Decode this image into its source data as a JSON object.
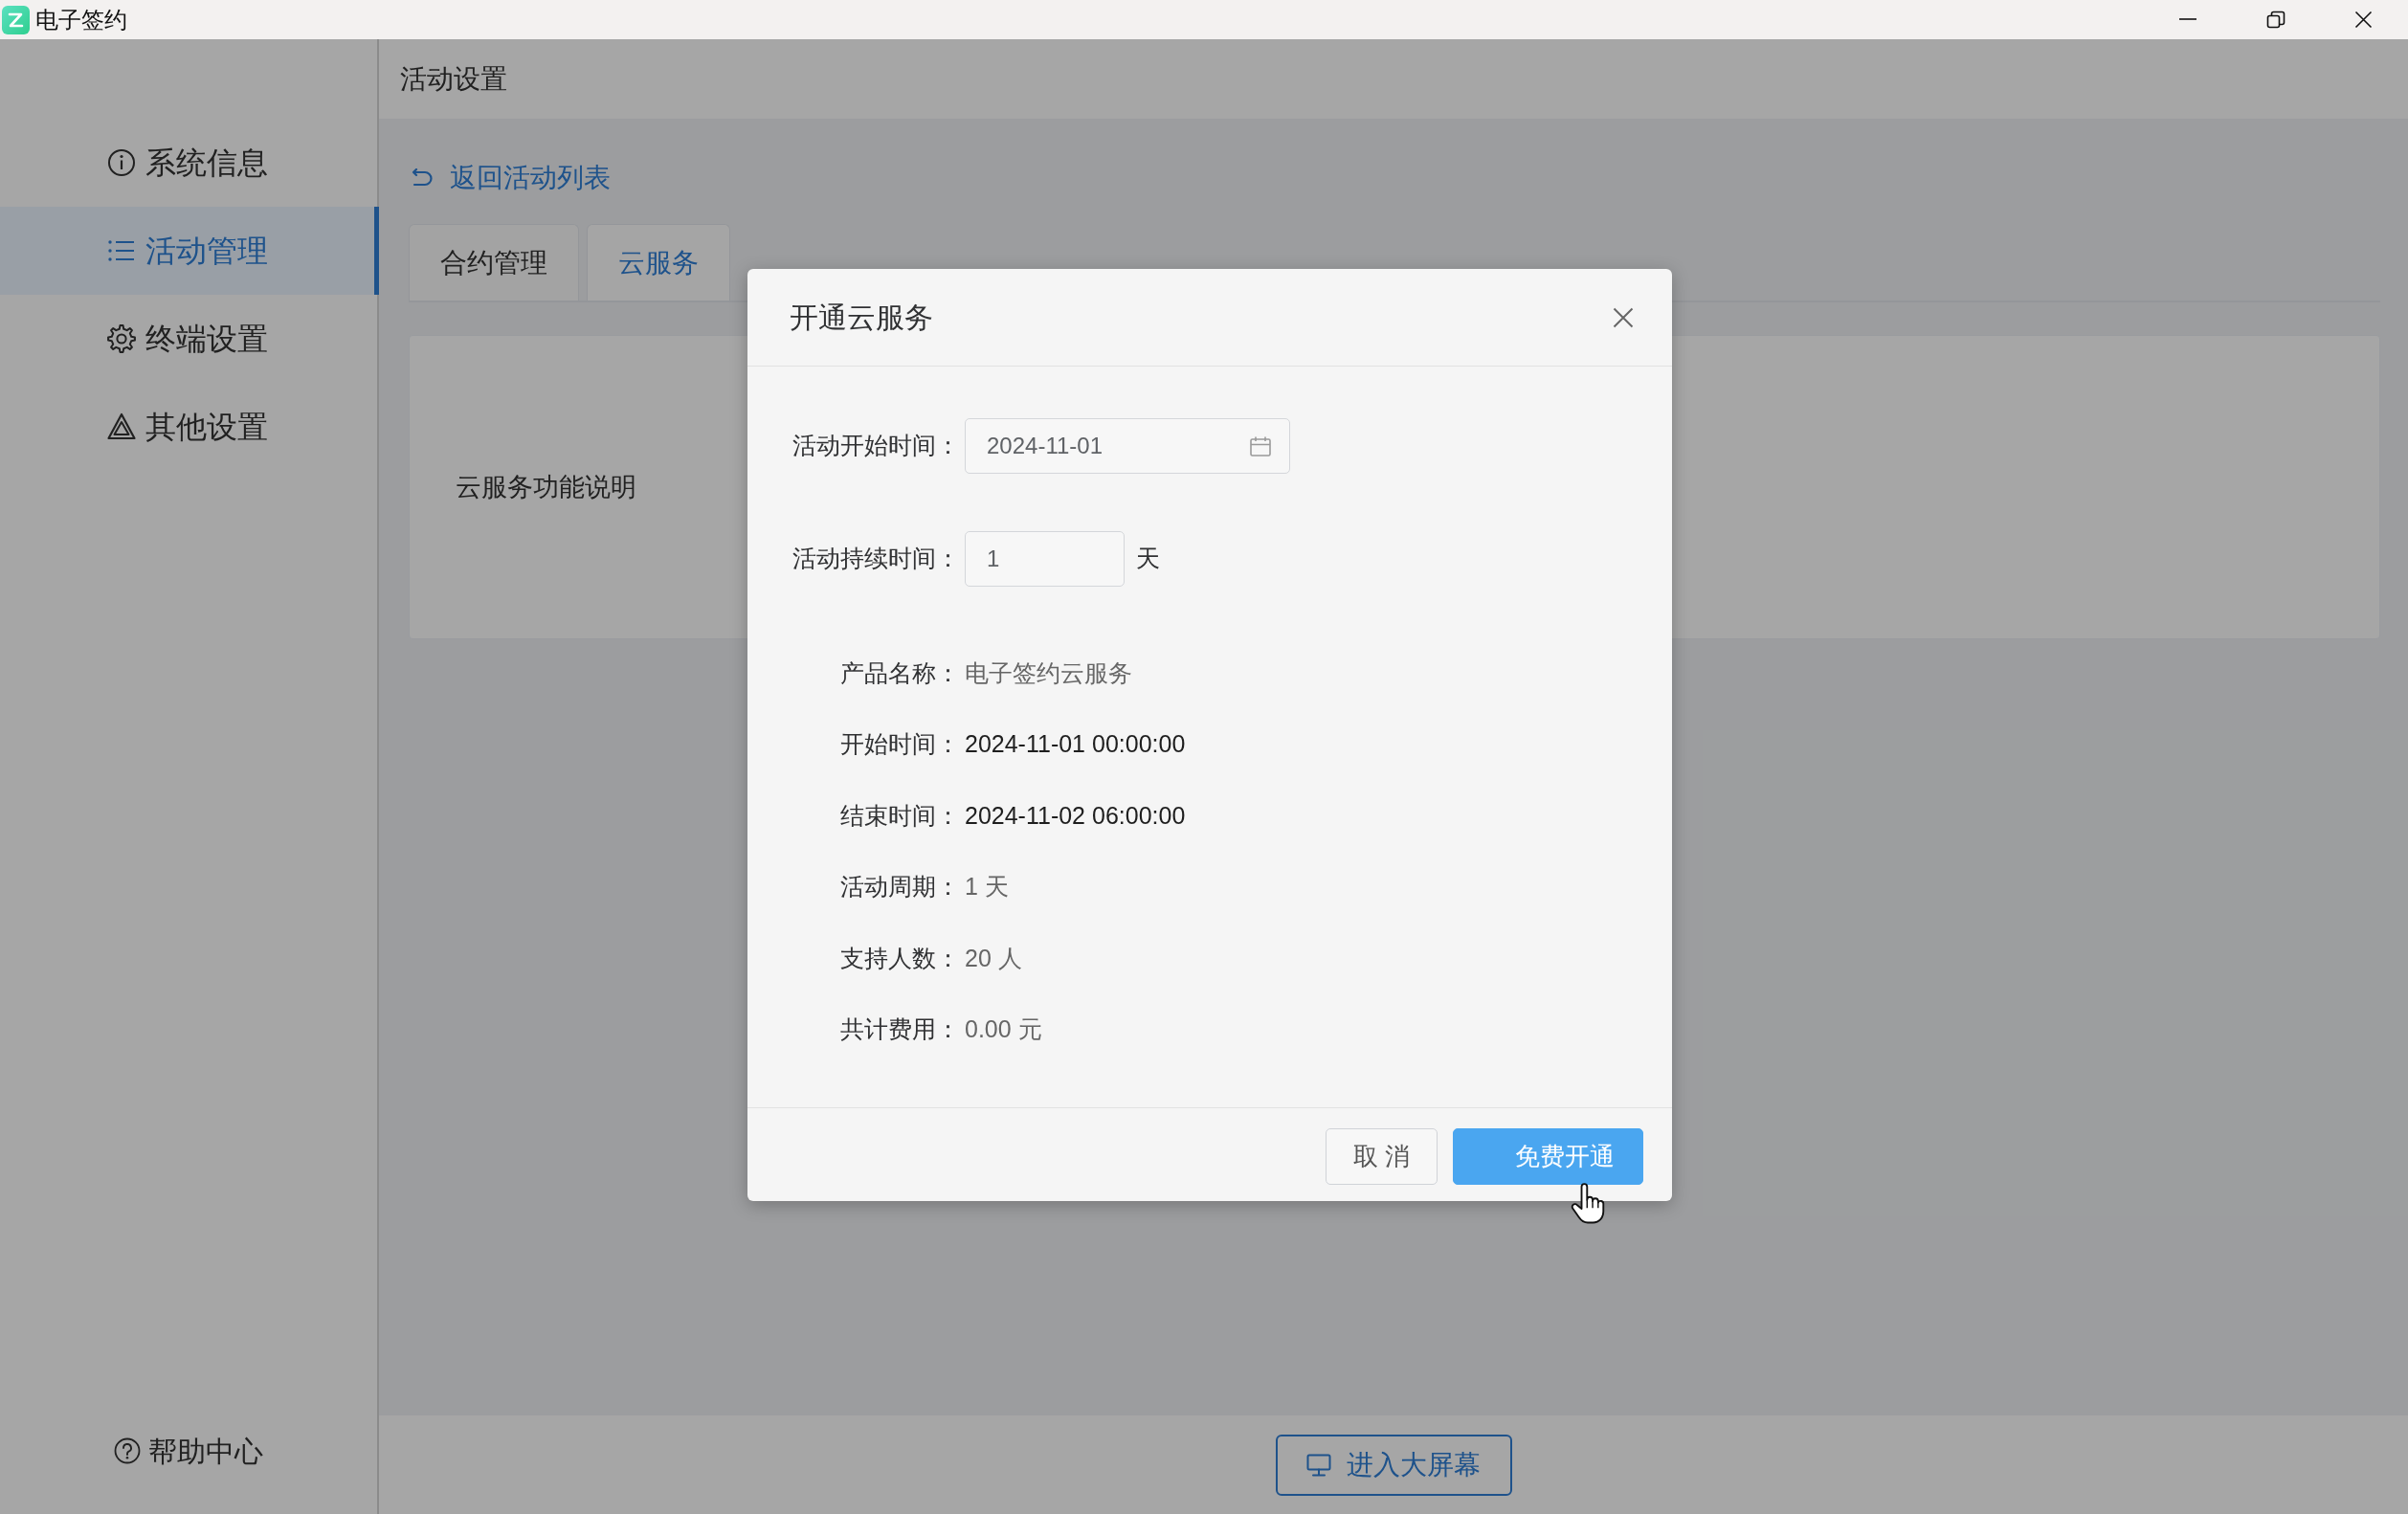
{
  "window": {
    "title": "电子签约"
  },
  "sidebar": {
    "items": [
      {
        "label": "系统信息",
        "selected": false
      },
      {
        "label": "活动管理",
        "selected": true
      },
      {
        "label": "终端设置",
        "selected": false
      },
      {
        "label": "其他设置",
        "selected": false
      }
    ],
    "help": {
      "label": "帮助中心"
    }
  },
  "header": {
    "title": "活动设置"
  },
  "back_link": {
    "label": "返回活动列表"
  },
  "tabs": [
    {
      "label": "合约管理",
      "selected": false
    },
    {
      "label": "云服务",
      "selected": true
    }
  ],
  "cloud_panel": {
    "label": "云服务功能说明"
  },
  "bottom_bar": {
    "button": {
      "label": "进入大屏幕"
    }
  },
  "dialog": {
    "title": "开通云服务",
    "fields": [
      {
        "label": "活动开始时间：",
        "value": "2024-11-01",
        "kind": "date"
      },
      {
        "label": "活动持续时间：",
        "value": "1",
        "kind": "number",
        "unit": "天"
      }
    ],
    "details": [
      {
        "label": "产品名称：",
        "value": "电子签约云服务",
        "kind": "plain"
      },
      {
        "label": "开始时间：",
        "value": "2024-11-01 00:00:00",
        "kind": "time"
      },
      {
        "label": "结束时间：",
        "value": "2024-11-02 06:00:00",
        "kind": "time"
      },
      {
        "label": "活动周期：",
        "value": "1 天",
        "kind": "plain"
      },
      {
        "label": "支持人数：",
        "value": "20 人",
        "kind": "plain"
      },
      {
        "label": "共计费用：",
        "value": "0.00 元",
        "kind": "plain"
      }
    ],
    "buttons": [
      {
        "label": "取 消",
        "kind": "default"
      },
      {
        "label": "免费开通",
        "kind": "primary"
      }
    ]
  }
}
